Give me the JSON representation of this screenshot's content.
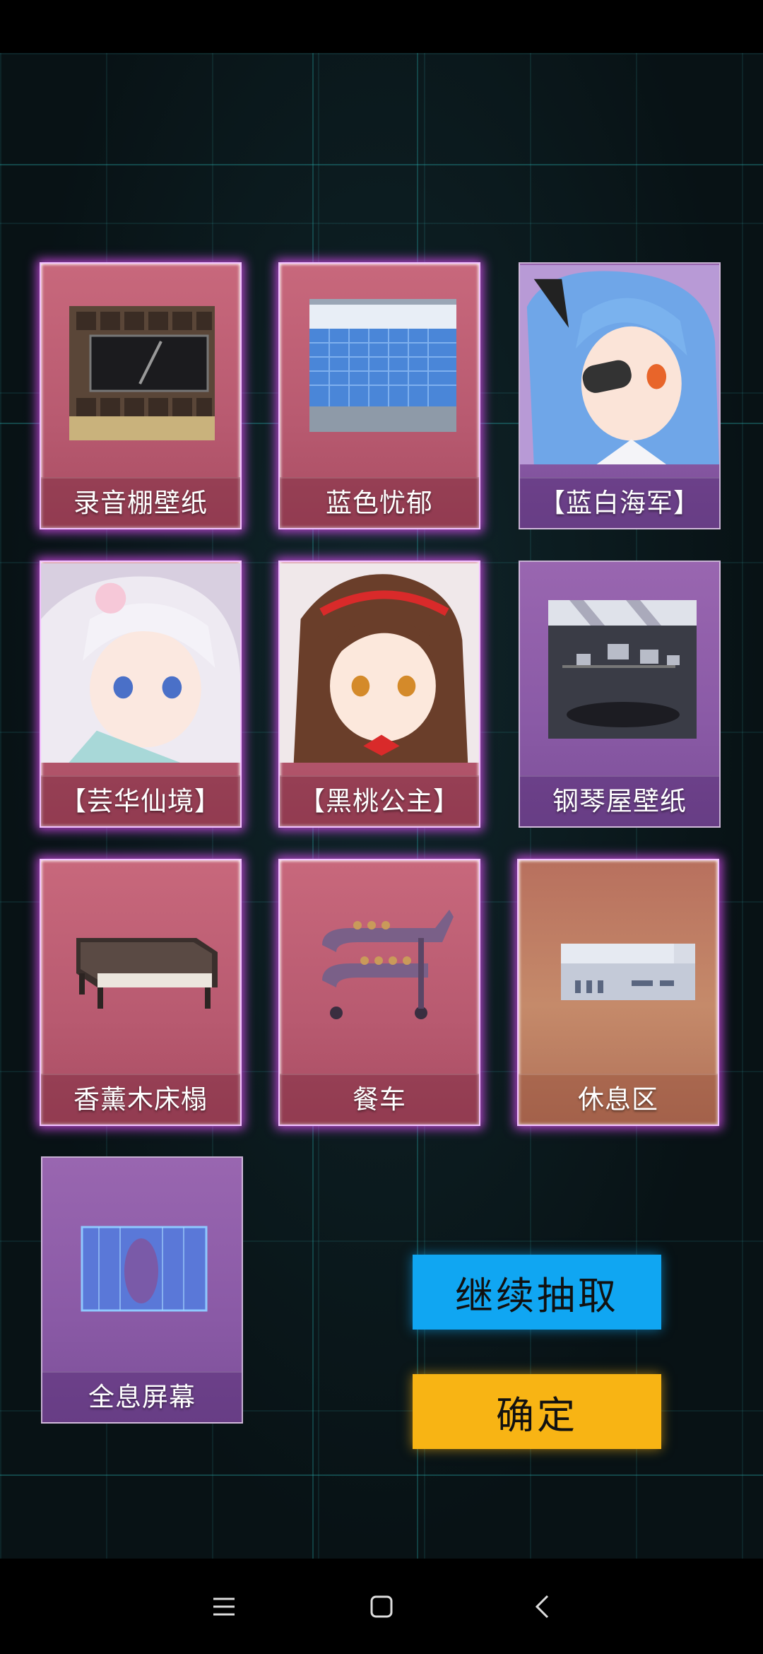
{
  "cards": [
    {
      "label": "录音棚壁纸",
      "theme": "pink",
      "art": "recording-studio-wallpaper"
    },
    {
      "label": "蓝色忧郁",
      "theme": "pink",
      "art": "blue-tile-room"
    },
    {
      "label": "【蓝白海军】",
      "theme": "purple",
      "art": "blue-hair-eyepatch-girl"
    },
    {
      "label": "【芸华仙境】",
      "theme": "pink",
      "art": "silver-hair-flower-girl"
    },
    {
      "label": "【黑桃公主】",
      "theme": "pink",
      "art": "brown-hair-red-headband-girl"
    },
    {
      "label": "钢琴屋壁纸",
      "theme": "purple",
      "art": "piano-room-wallpaper"
    },
    {
      "label": "香薰木床榻",
      "theme": "pink",
      "art": "wooden-daybed"
    },
    {
      "label": "餐车",
      "theme": "pink",
      "art": "dining-cart"
    },
    {
      "label": "休息区",
      "theme": "orange",
      "art": "rest-area-sofa"
    },
    {
      "label": "全息屏幕",
      "theme": "purple",
      "art": "hologram-screen"
    }
  ],
  "buttons": {
    "continue_label": "继续抽取",
    "confirm_label": "确定"
  },
  "colors": {
    "continue": "#10a6f2",
    "confirm": "#f8b414",
    "glow": "#e650ff"
  },
  "nav": {
    "menu_icon": "menu-icon",
    "home_icon": "home-square-icon",
    "back_icon": "back-chevron-icon"
  }
}
